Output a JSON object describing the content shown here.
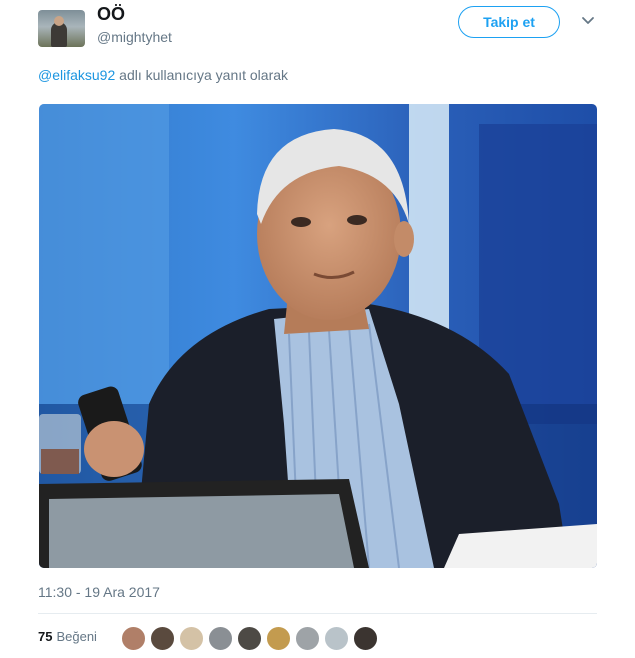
{
  "tweet": {
    "display_name": "OÖ",
    "handle": "@mightyhet",
    "follow_label": "Takip et",
    "reply_to_mention": "@elifaksu92",
    "reply_to_suffix": " adlı kullanıcıya yanıt olarak",
    "timestamp": "11:30 - 19 Ara 2017",
    "likes_count": "75",
    "likes_label": "Beğeni"
  },
  "icons": {
    "avatar": "user-avatar",
    "menu": "chevron-down-icon",
    "media": "photo"
  },
  "likers": [
    {
      "name": "liker-avatar-1",
      "color": "#b07f68"
    },
    {
      "name": "liker-avatar-2",
      "color": "#5a4a3e"
    },
    {
      "name": "liker-avatar-3",
      "color": "#d4c2a6"
    },
    {
      "name": "liker-avatar-4",
      "color": "#8a8f94"
    },
    {
      "name": "liker-avatar-5",
      "color": "#4d4a45"
    },
    {
      "name": "liker-avatar-6",
      "color": "#c39b4f"
    },
    {
      "name": "liker-avatar-7",
      "color": "#9ea3a7"
    },
    {
      "name": "liker-avatar-8",
      "color": "#b9c3c9"
    },
    {
      "name": "liker-avatar-9",
      "color": "#3b3430"
    }
  ],
  "colors": {
    "accent": "#1da1f2",
    "link": "#1b95e0",
    "muted": "#657786"
  }
}
